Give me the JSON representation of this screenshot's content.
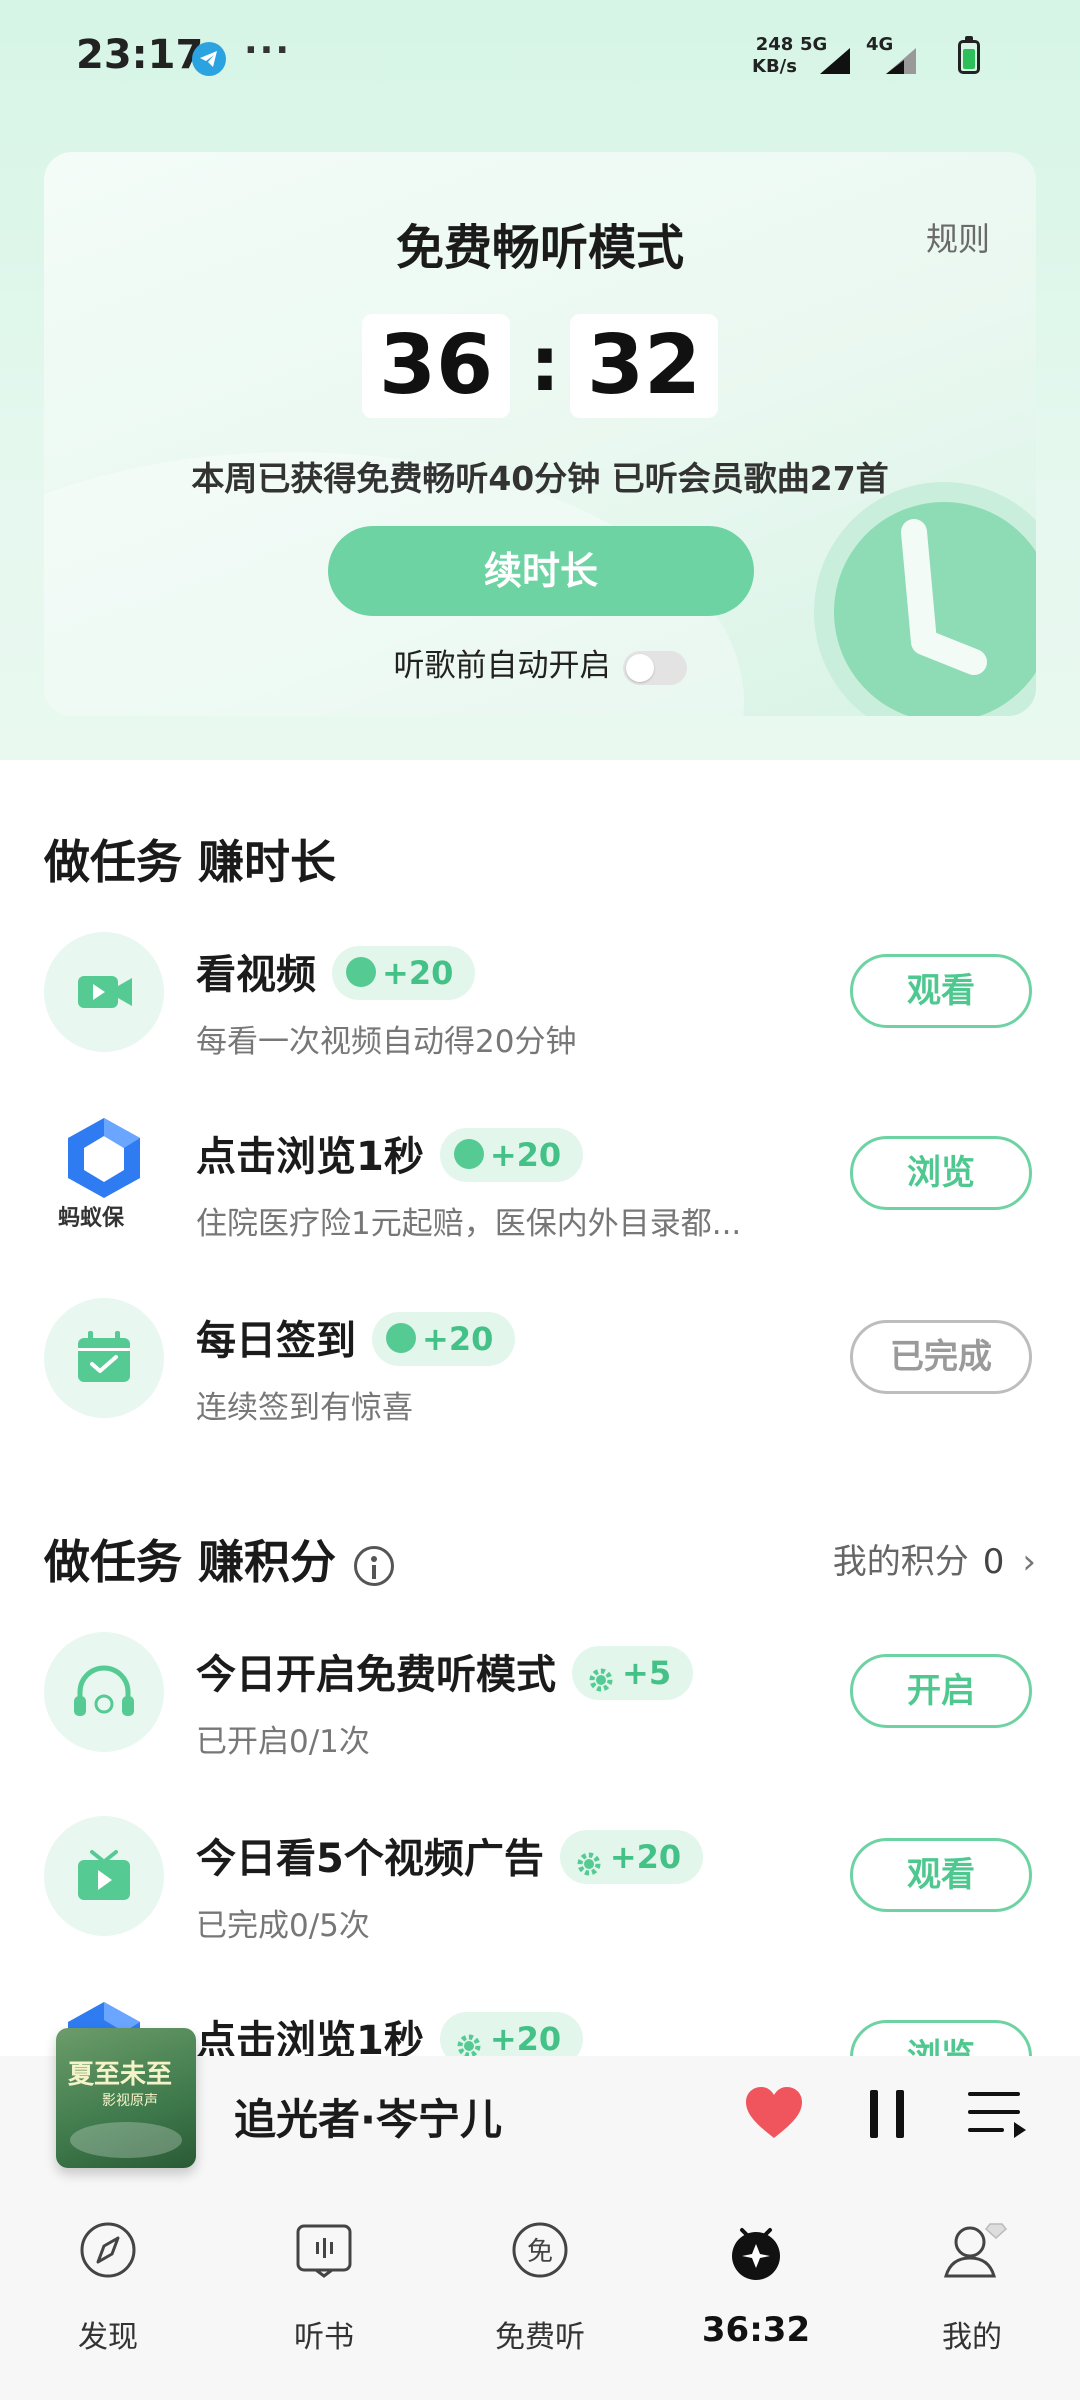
{
  "status_bar": {
    "time": "23:17",
    "more": "···",
    "net_speed_value": "248",
    "net_speed_unit": "KB/s",
    "network_1": "5G",
    "network_2": "4G",
    "icons": [
      "telegram-icon",
      "signal-icon",
      "battery-icon"
    ]
  },
  "free_mode": {
    "title": "免费畅听模式",
    "rules_label": "规则",
    "timer": {
      "minutes": "36",
      "separator": ":",
      "seconds": "32"
    },
    "summary": "本周已获得免费畅听40分钟 已听会员歌曲27首",
    "renew_label": "续时长",
    "auto_start_label": "听歌前自动开启",
    "auto_start_enabled": false
  },
  "time_tasks": {
    "title": "做任务 赚时长",
    "items": [
      {
        "icon": "video-camera-icon",
        "title": "看视频",
        "reward": "+20",
        "desc": "每看一次视频自动得20分钟",
        "button": "观看",
        "done": false
      },
      {
        "icon": "ant-insurance-logo",
        "title": "点击浏览1秒",
        "reward": "+20",
        "desc": "住院医疗险1元起赔，医保内外目录都...",
        "button": "浏览",
        "done": false,
        "logo_text": "蚂蚁保"
      },
      {
        "icon": "calendar-check-icon",
        "title": "每日签到",
        "reward": "+20",
        "desc": "连续签到有惊喜",
        "button": "已完成",
        "done": true
      }
    ]
  },
  "points_tasks": {
    "title": "做任务 赚积分",
    "my_points_label": "我的积分",
    "my_points_value": "0",
    "items": [
      {
        "icon": "headphones-icon",
        "title": "今日开启免费听模式",
        "reward": "+5",
        "desc": "已开启0/1次",
        "button": "开启"
      },
      {
        "icon": "tv-play-icon",
        "title": "今日看5个视频广告",
        "reward": "+20",
        "desc": "已完成0/5次",
        "button": "观看"
      },
      {
        "icon": "ant-insurance-logo",
        "title": "点击浏览1秒",
        "reward": "+20",
        "desc": "",
        "button": "浏览"
      }
    ]
  },
  "player": {
    "title": "追光者·岑宁儿",
    "cover_title": "夏至未至",
    "cover_sub": "影视原声",
    "liked": true
  },
  "bottom_nav": {
    "items": [
      {
        "label": "发现",
        "icon": "compass-icon",
        "active": false
      },
      {
        "label": "听书",
        "icon": "book-audio-icon",
        "active": false
      },
      {
        "label": "免费听",
        "icon": "free-listen-icon",
        "active": false
      },
      {
        "label": "36:32",
        "icon": "free-timer-icon",
        "active": true
      },
      {
        "label": "我的",
        "icon": "profile-icon",
        "active": false
      }
    ]
  },
  "colors": {
    "accent": "#6dd3a3",
    "accent_text": "#4fc88f",
    "heart": "#f0545c"
  }
}
